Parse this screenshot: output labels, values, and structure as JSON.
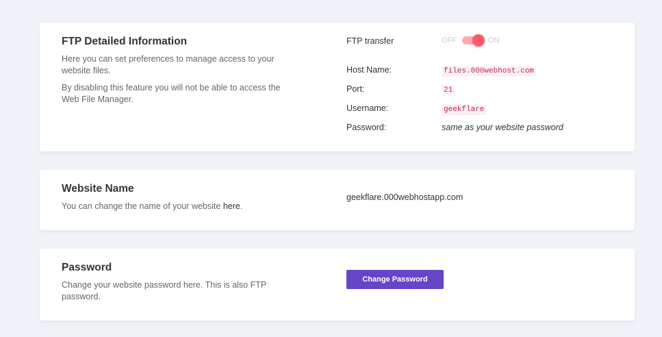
{
  "ftp": {
    "title": "FTP Detailed Information",
    "desc1": "Here you can set preferences to manage access to your website files.",
    "desc2": "By disabling this feature you will not be able to access the Web File Manager.",
    "transfer_label": "FTP transfer",
    "off": "OFF",
    "on": "ON",
    "toggle_on": true,
    "host_label": "Host Name:",
    "host": "files.000webhost.com",
    "port_label": "Port:",
    "port": "21",
    "user_label": "Username:",
    "user": "geekflare",
    "pass_label": "Password:",
    "pass": "same as your website password"
  },
  "website": {
    "title": "Website Name",
    "desc": "You can change the name of your website ",
    "link": "here",
    "period": ".",
    "name": "geekflare.000webhostapp.com"
  },
  "password": {
    "title": "Password",
    "desc": "Change your website password here. This is also FTP password.",
    "button": "Change Password"
  }
}
